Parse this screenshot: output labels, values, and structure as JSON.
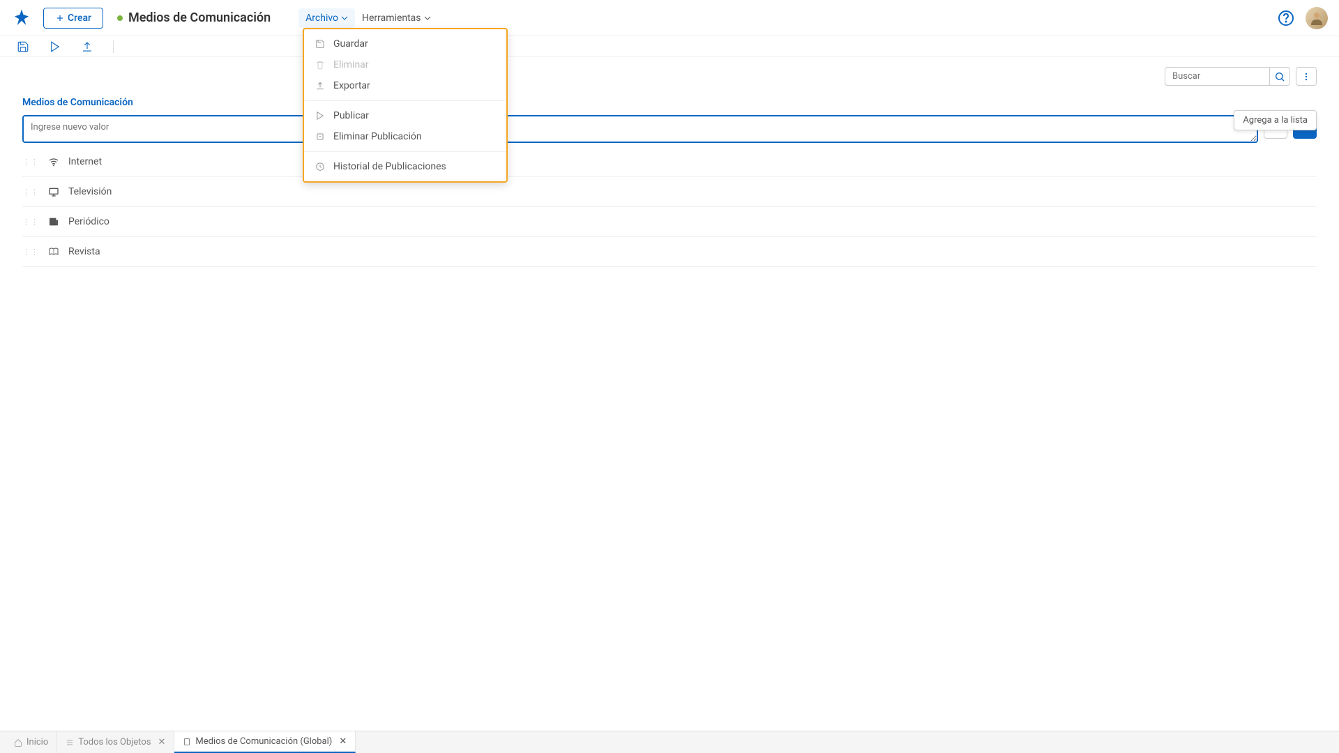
{
  "header": {
    "create_label": "Crear",
    "page_title": "Medios de Comunicación",
    "menu_archive": "Archivo",
    "menu_tools": "Herramientas"
  },
  "dropdown": {
    "items": [
      {
        "label": "Guardar",
        "icon": "save",
        "disabled": false
      },
      {
        "label": "Eliminar",
        "icon": "trash",
        "disabled": true
      },
      {
        "label": "Exportar",
        "icon": "export",
        "disabled": false
      }
    ],
    "section2": [
      {
        "label": "Publicar",
        "icon": "play"
      },
      {
        "label": "Eliminar Publicación",
        "icon": "unpublish"
      }
    ],
    "section3": [
      {
        "label": "Historial de Publicaciones",
        "icon": "history"
      }
    ]
  },
  "search": {
    "placeholder": "Buscar"
  },
  "section": {
    "title": "Medios de Comunicación"
  },
  "input": {
    "placeholder": "Ingrese nuevo valor"
  },
  "tooltip": "Agrega a la lista",
  "list": [
    {
      "label": "Internet",
      "icon": "wifi"
    },
    {
      "label": "Televisión",
      "icon": "tv"
    },
    {
      "label": "Periódico",
      "icon": "newspaper"
    },
    {
      "label": "Revista",
      "icon": "book"
    }
  ],
  "tabs": [
    {
      "label": "Inicio",
      "icon": "home",
      "closable": false,
      "active": false
    },
    {
      "label": "Todos los Objetos",
      "icon": "list",
      "closable": true,
      "active": false
    },
    {
      "label": "Medios de Comunicación (Global)",
      "icon": "doc",
      "closable": true,
      "active": true
    }
  ]
}
